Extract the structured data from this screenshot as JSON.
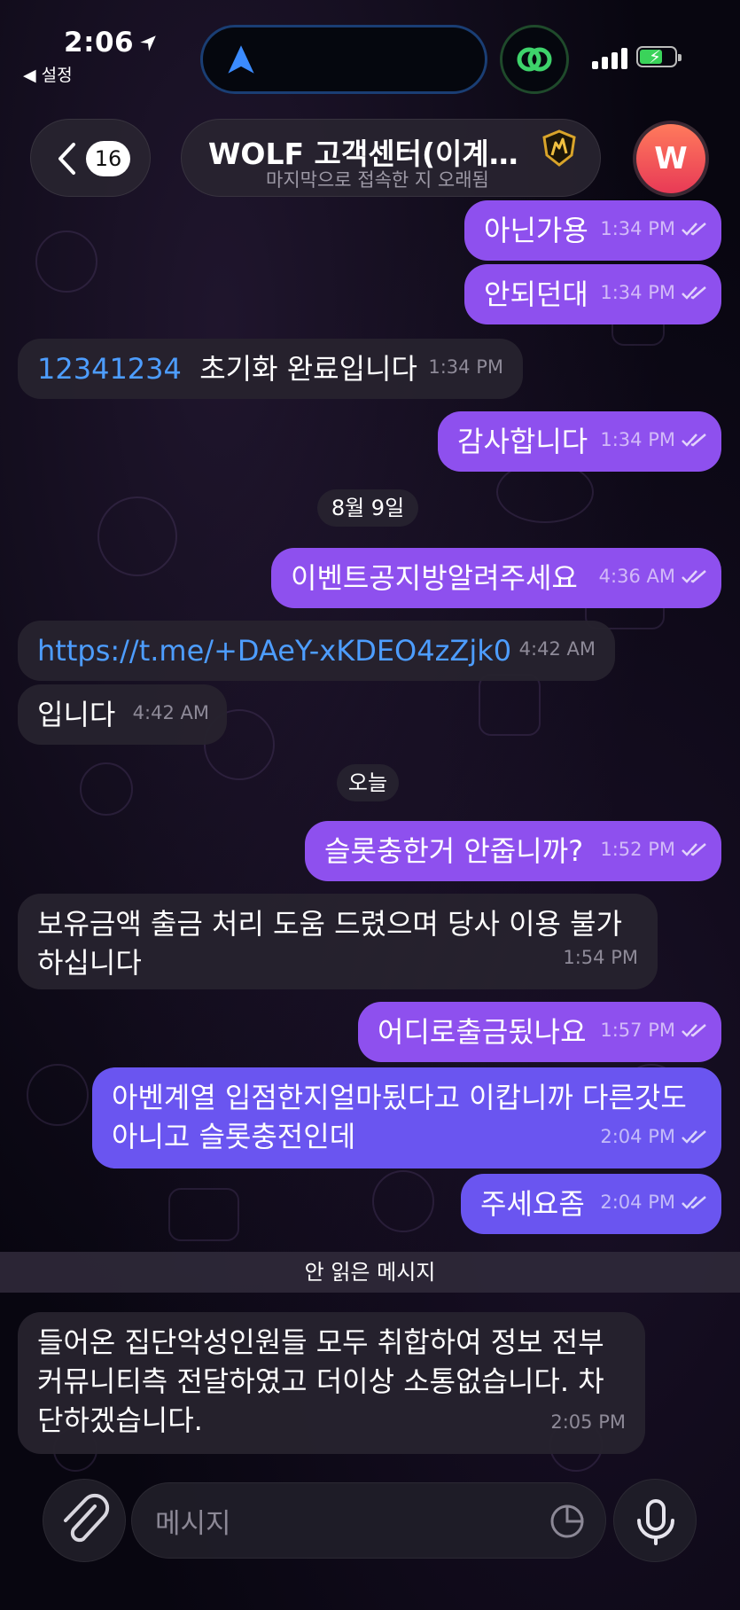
{
  "status_bar": {
    "time": "2:06",
    "back_app": "◀ 설정"
  },
  "header": {
    "unread_count": "16",
    "title": "WOLF 고객센터(이계정…",
    "subtitle": "마지막으로 접속한 지 오래됨",
    "avatar_letter": "W"
  },
  "messages": [
    {
      "text": "아닌가용",
      "time": "1:34 PM"
    },
    {
      "text": "안되던대",
      "time": "1:34 PM"
    },
    {
      "link": "12341234",
      "text": "초기화 완료입니다",
      "time": "1:34 PM"
    },
    {
      "text": "감사합니다",
      "time": "1:34 PM"
    },
    {
      "text": "이벤트공지방알려주세요",
      "time": "4:36 AM"
    },
    {
      "link": "https://t.me/+DAeY-xKDEO4zZjk0",
      "time": "4:42 AM"
    },
    {
      "text": "입니다",
      "time": "4:42 AM"
    },
    {
      "text": "슬롯충한거 안줍니까?",
      "time": "1:52 PM"
    },
    {
      "line1": "보유금액 출금 처리 도움 드렸으며 당사 이용 불가",
      "line2": "하십니다",
      "time": "1:54 PM"
    },
    {
      "text": "어디로출금됬나요",
      "time": "1:57 PM"
    },
    {
      "line1": "아벤계열 입점한지얼마됬다고 이캅니까 다른갓도",
      "line2": "아니고 슬롯충전인데",
      "time": "2:04 PM"
    },
    {
      "text": "주세요좀",
      "time": "2:04 PM"
    },
    {
      "line1": "들어온 집단악성인원들 모두 취합하여 정보 전부",
      "line2": "커뮤니티측 전달하였고 더이상 소통없습니다. 차",
      "line3": "단하겠습니다.",
      "time": "2:05 PM"
    }
  ],
  "date_chips": {
    "aug9": "8월 9일",
    "today": "오늘"
  },
  "unread_divider": "안 읽은 메시지",
  "composer": {
    "placeholder": "메시지"
  },
  "colors": {
    "outgoing_bubble": "#8e50ee",
    "outgoing_bubble_recent": "#6a55f0",
    "incoming_bubble": "#26222e",
    "link": "#4d9dff",
    "avatar": "#f05058"
  }
}
